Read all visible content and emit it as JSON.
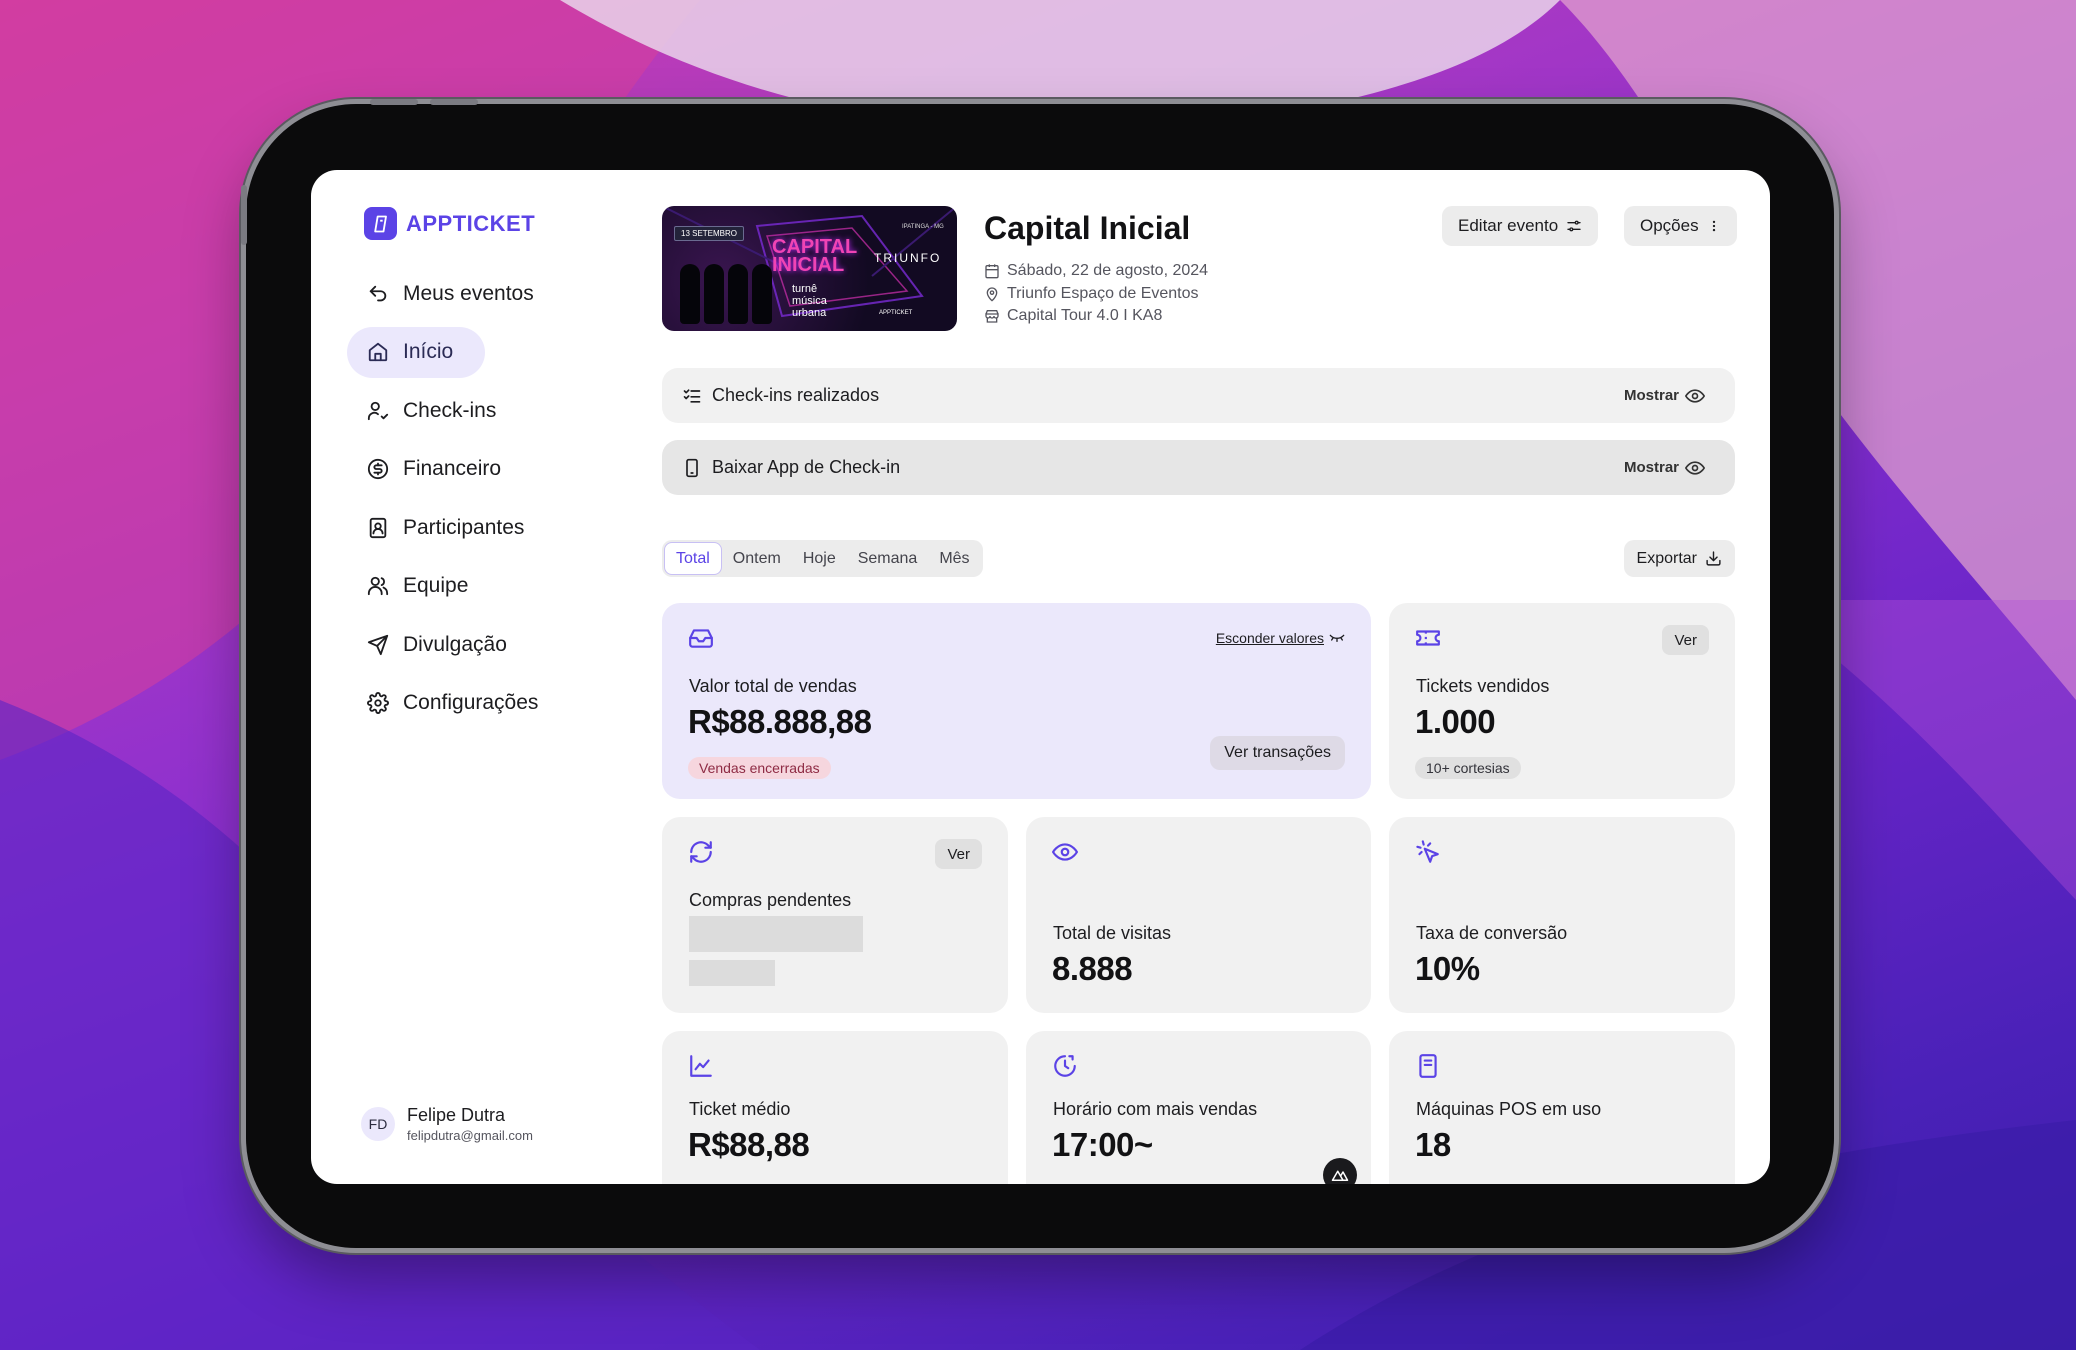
{
  "brand": {
    "name": "APPTICKET",
    "color": "#5b43e6"
  },
  "sidebar": {
    "items": [
      {
        "label": "Meus eventos",
        "icon": "back-arrow-icon"
      },
      {
        "label": "Início",
        "icon": "home-icon",
        "active": true
      },
      {
        "label": "Check-ins",
        "icon": "user-check-icon"
      },
      {
        "label": "Financeiro",
        "icon": "dollar-circle-icon"
      },
      {
        "label": "Participantes",
        "icon": "contact-book-icon"
      },
      {
        "label": "Equipe",
        "icon": "users-icon"
      },
      {
        "label": "Divulgação",
        "icon": "send-icon"
      },
      {
        "label": "Configurações",
        "icon": "gear-icon"
      }
    ],
    "user": {
      "initials": "FD",
      "name": "Felipe Dutra",
      "email": "felipdutra@gmail.com"
    }
  },
  "event": {
    "title": "Capital Inicial",
    "date": "Sábado, 22 de agosto, 2024",
    "venue": "Triunfo Espaço de Eventos",
    "tour": "Capital Tour 4.0 I KA8",
    "poster": {
      "date_tag": "13 SETEMBRO",
      "title_line1": "CAPITAL",
      "title_line2": "INICIAL",
      "subtitle_line1": "turnê",
      "subtitle_line2": "música",
      "subtitle_line3": "urbana",
      "venue_text": "TRIUNFO",
      "city": "IPATINGA - MG",
      "brand": "APPTICKET"
    }
  },
  "header_buttons": {
    "edit": "Editar evento",
    "options": "Opções"
  },
  "bars": [
    {
      "label": "Check-ins realizados",
      "action": "Mostrar",
      "icon": "checklist-icon"
    },
    {
      "label": "Baixar App de Check-in",
      "action": "Mostrar",
      "icon": "smartphone-icon"
    }
  ],
  "tabs": [
    "Total",
    "Ontem",
    "Hoje",
    "Semana",
    "Mês"
  ],
  "active_tab": "Total",
  "export_label": "Exportar",
  "cards": {
    "sales": {
      "label": "Valor total de vendas",
      "value": "R$88.888,88",
      "status": "Vendas encerradas",
      "hide_values": "Esconder valores",
      "transactions": "Ver transações"
    },
    "tickets": {
      "label": "Tickets vendidos",
      "value": "1.000",
      "badge": "10+ cortesias",
      "action": "Ver"
    },
    "pending": {
      "label": "Compras pendentes",
      "action": "Ver"
    },
    "visits": {
      "label": "Total de visitas",
      "value": "8.888"
    },
    "conversion": {
      "label": "Taxa de conversão",
      "value": "10%"
    },
    "avg_ticket": {
      "label": "Ticket médio",
      "value": "R$88,88"
    },
    "peak_hour": {
      "label": "Horário com mais vendas",
      "value": "17:00~"
    },
    "pos": {
      "label": "Máquinas POS em uso",
      "value": "18"
    }
  }
}
